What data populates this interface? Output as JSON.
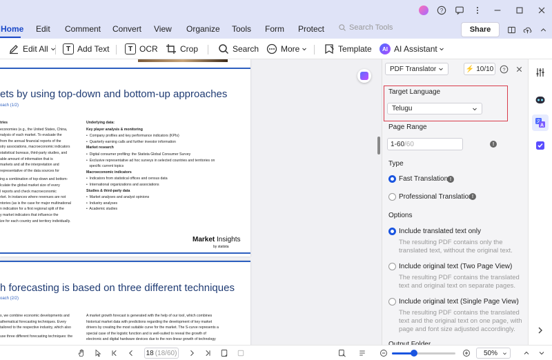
{
  "menu": {
    "tabs": [
      "Home",
      "Edit",
      "Comment",
      "Convert",
      "View",
      "Organize",
      "Tools",
      "Form",
      "Protect"
    ],
    "active": "Home",
    "search_placeholder": "Search Tools",
    "share_label": "Share"
  },
  "toolbar": {
    "edit_all": "Edit All",
    "add_text": "Add Text",
    "ocr": "OCR",
    "crop": "Crop",
    "search": "Search",
    "more": "More",
    "template": "Template",
    "ai_assistant": "AI Assistant"
  },
  "document": {
    "page1": {
      "title": "ets by using top-down and bottom-up approaches",
      "subtitle": "oach (1/2)",
      "left_col": [
        "tries",
        " economies (e.g., the United States, China,",
        "nalysis of each market. To evaluate the",
        " from the annual financial reports of the",
        "stry associations, macroeconomic indicators",
        "statistical bureaus, third-party studies, and",
        "able amount of information that is",
        "markets and all the interpretation and",
        "representative of the data sources for",
        "",
        "ing a combination of top-down and bottom-",
        "lculate the global market size of every",
        "l reports and check macroeconomic",
        "rket. In instances where revenues are not",
        "ntories (as is the case for major multinational",
        "n indication for a first regional split of the",
        "y market indicators that influence the",
        "ize for each country and territory individually."
      ],
      "right_col": {
        "h1": "Underlying data:",
        "h2": "Key player analysis & monitoring",
        "b1": [
          "Company profiles and key performance indicators (KPIs)",
          "Quarterly earning calls and further investor information"
        ],
        "h3": "Market research",
        "b2": [
          "Digital consumer profiling: the Statista Global Consumer Survey",
          "Exclusive representative ad hoc surveys in selected countries and territories on",
          "specific current topics"
        ],
        "h4": "Macroeconomic indicators",
        "b3": [
          "Indicators from statistical offices and census data",
          "International organizations and associations"
        ],
        "h5": "Studies & third-party data",
        "b4": [
          "Market analyses and analyst opinions",
          "Industry analyses",
          "Academic studies"
        ]
      },
      "logo_main": "Market",
      "logo_sub": "Insights",
      "logo_by": "by statista"
    },
    "page2": {
      "title": "h forecasting is based on three different techniques",
      "subtitle": "oach (2/2)",
      "left_col": [
        "s, we combine economic developments and",
        "athematical forecasting techniques. Every",
        "tailored to the respective industry, which also",
        "",
        "use three different forecasting techniques: the"
      ],
      "right_col": [
        "A market growth forecast is generated with the help of our tool, which combines",
        "historical market data with predictions regarding the development of key market",
        "drivers by creating the most suitable curve for the market. The S-curve represents a",
        "special case of the logistic function and is well-suited to reveal the growth of",
        "electronic and digital hardware devices due to the non-linear growth of technology"
      ]
    }
  },
  "panel": {
    "service": "PDF Translator",
    "quota": "10/10",
    "target_language_label": "Target Language",
    "target_language_value": "Telugu",
    "page_range_label": "Page Range",
    "page_range_value": "1-60",
    "page_range_total": "/60",
    "type_label": "Type",
    "type_options": [
      "Fast Translation",
      "Professional Translation"
    ],
    "options_label": "Options",
    "option1_title": "Include translated text only",
    "option1_desc": "The resulting PDF contains only the translated text, without the original text.",
    "option2_title": "Include original text (Two Page View)",
    "option2_desc": "The resulting PDF contains the translated text and original text on separate pages.",
    "option3_title": "Include original text (Single Page View)",
    "option3_desc": "The resulting PDF contains the translated text and the original text on one page, with page and font size adjusted accordingly.",
    "output_label": "Output Folder"
  },
  "statusbar": {
    "current_page": "18",
    "page_total": "(18/60)",
    "zoom": "50%",
    "zoom_fraction": 0.35
  }
}
